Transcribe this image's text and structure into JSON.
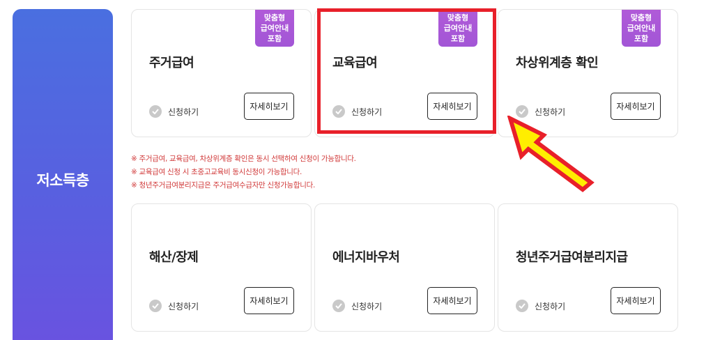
{
  "sidebar": {
    "title": "저소득층"
  },
  "cards": [
    {
      "title": "주거급여",
      "badge": [
        "맞춤형",
        "급여안내",
        "포함"
      ],
      "apply_label": "신청하기",
      "detail_label": "자세히보기"
    },
    {
      "title": "교육급여",
      "badge": [
        "맞춤형",
        "급여안내",
        "포함"
      ],
      "apply_label": "신청하기",
      "detail_label": "자세히보기"
    },
    {
      "title": "차상위계층 확인",
      "badge": [
        "맞춤형",
        "급여안내",
        "포함"
      ],
      "apply_label": "신청하기",
      "detail_label": "자세히보기"
    },
    {
      "title": "해산/장제",
      "apply_label": "신청하기",
      "detail_label": "자세히보기"
    },
    {
      "title": "에너지바우처",
      "apply_label": "신청하기",
      "detail_label": "자세히보기"
    },
    {
      "title": "청년주거급여분리지급",
      "apply_label": "신청하기",
      "detail_label": "자세히보기"
    }
  ],
  "notes": [
    "※ 주거급여, 교육급여, 차상위계층 확인은 동시 선택하여 신청이 가능합니다.",
    "※ 교육급여 신청 시 초중고교육비 동시신청이 가능합니다.",
    "※ 청년주거급여분리지급은 주거급여수급자만 신청가능합니다."
  ],
  "colors": {
    "sidebar_gradient_top": "#4a6fe0",
    "sidebar_gradient_bottom": "#6a52e0",
    "badge": "#a95ad6",
    "note_text": "#d13a3a",
    "highlight_box": "#e8202a",
    "arrow_fill": "#ffee00",
    "arrow_stroke": "#e8202a"
  },
  "icons": {
    "apply": "check-circle-icon",
    "pointer": "arrow-icon"
  }
}
